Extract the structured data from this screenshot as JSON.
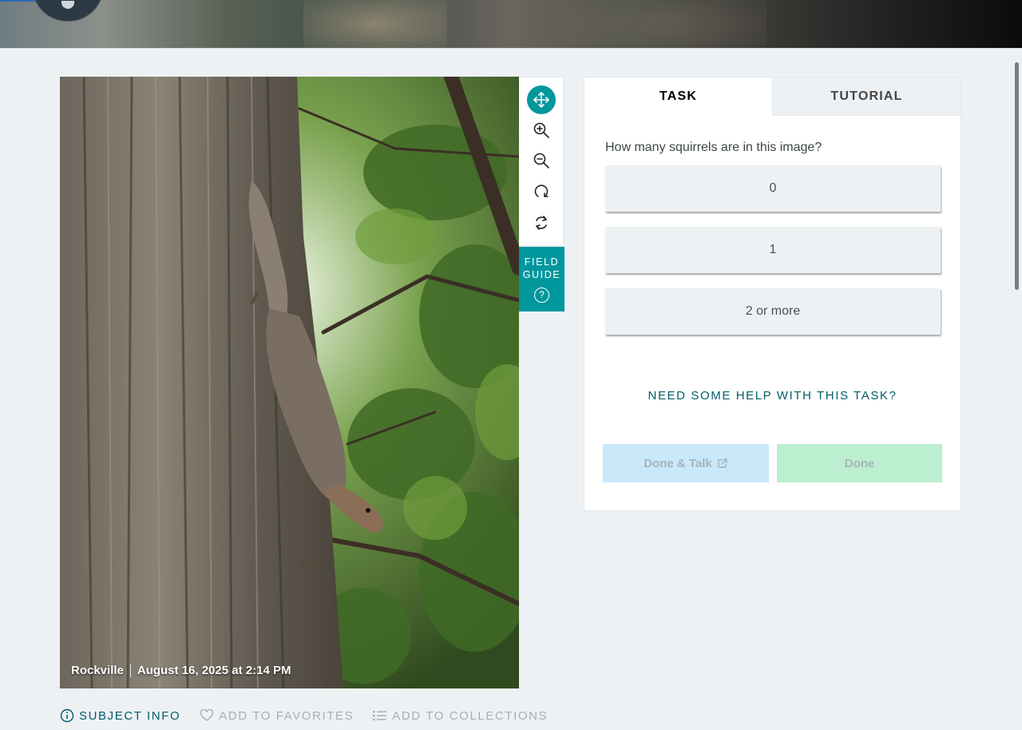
{
  "subject": {
    "caption_place": "Rockville",
    "caption_date": "August 16, 2025 at 2:14 PM"
  },
  "toolbar": {
    "tools": [
      {
        "icon": "move-icon",
        "active": true
      },
      {
        "icon": "zoom-in-icon"
      },
      {
        "icon": "zoom-out-icon"
      },
      {
        "icon": "rotate-icon"
      },
      {
        "icon": "reset-icon"
      }
    ],
    "field_guide_line1": "FIELD",
    "field_guide_line2": "GUIDE",
    "field_guide_icon_glyph": "?"
  },
  "panel": {
    "tabs": [
      {
        "label": "TASK",
        "active": true
      },
      {
        "label": "TUTORIAL",
        "active": false
      }
    ],
    "question": "How many squirrels are in this image?",
    "answers": [
      "0",
      "1",
      "2 or more"
    ],
    "help_link": "NEED SOME HELP WITH THIS TASK?",
    "done_talk_label": "Done & Talk",
    "done_label": "Done"
  },
  "meta": {
    "subject_info": "SUBJECT INFO",
    "add_favorites": "ADD TO FAVORITES",
    "add_collections": "ADD TO COLLECTIONS"
  },
  "colors": {
    "accent": "#00979d",
    "link": "#005d69",
    "done_talk_bg": "#c9e9fb",
    "done_bg": "#bcefcf"
  }
}
